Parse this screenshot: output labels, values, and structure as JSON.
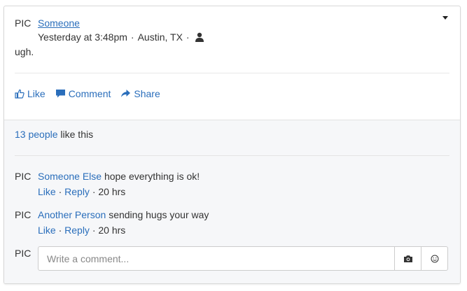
{
  "post": {
    "pic_label": "PIC",
    "author": "Someone",
    "time": "Yesterday at 3:48pm",
    "location": "Austin, TX",
    "meta_separator": "·",
    "text": "ugh."
  },
  "actions": {
    "like": "Like",
    "comment": "Comment",
    "share": "Share"
  },
  "likes": {
    "count_text": "13 people",
    "suffix": "like this"
  },
  "comments": [
    {
      "pic_label": "PIC",
      "name": "Someone Else",
      "text": "hope everything is ok!",
      "like": "Like",
      "reply": "Reply",
      "time": "20 hrs",
      "separator": "·"
    },
    {
      "pic_label": "PIC",
      "name": "Another Person",
      "text": "sending hugs your way",
      "like": "Like",
      "reply": "Reply",
      "time": "20 hrs",
      "separator": "·"
    }
  ],
  "composer": {
    "pic_label": "PIC",
    "placeholder": "Write a comment..."
  },
  "icons": {
    "options": "caret-down-icon",
    "audience": "person-icon",
    "like": "thumbs-up-icon",
    "comment": "speech-bubble-icon",
    "share": "share-arrow-icon",
    "camera": "camera-icon",
    "emoji": "smiley-icon"
  },
  "colors": {
    "link": "#2a6ebb",
    "text": "#333333",
    "panel_bg": "#f6f7f9"
  }
}
